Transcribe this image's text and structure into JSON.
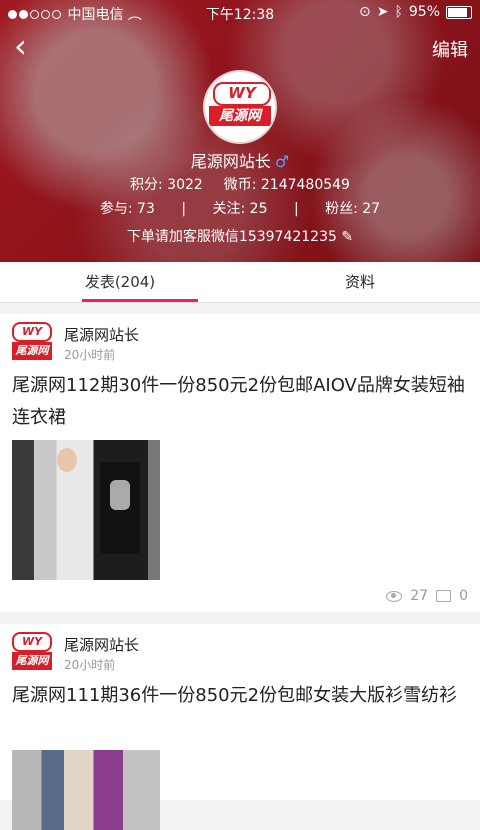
{
  "status_bar": {
    "carrier": "中国电信",
    "time": "下午12:38",
    "battery": "95%"
  },
  "nav": {
    "edit_label": "编辑"
  },
  "profile": {
    "name": "尾源网站长",
    "avatar_text_top": "WY",
    "avatar_text_bottom": "尾源网",
    "points": "积分: 3022",
    "coins": "微币: 2147480549",
    "participate": "参与: 73",
    "follow": "关注: 25",
    "fans": "粉丝: 27",
    "note": "下单请加客服微信15397421235"
  },
  "tabs": [
    {
      "label": "发表(204)",
      "active": true
    },
    {
      "label": "资料",
      "active": false
    }
  ],
  "posts": [
    {
      "author": "尾源网站长",
      "time": "20小时前",
      "title": "尾源网112期30件一份850元2份包邮AIOV品牌女装短袖连衣裙",
      "views": "27",
      "comments": "0",
      "logo_top": "WY",
      "logo_bottom": "尾源网"
    },
    {
      "author": "尾源网站长",
      "time": "20小时前",
      "title": "尾源网111期36件一份850元2份包邮女装大版衫雪纺衫",
      "logo_top": "WY",
      "logo_bottom": "尾源网"
    }
  ]
}
